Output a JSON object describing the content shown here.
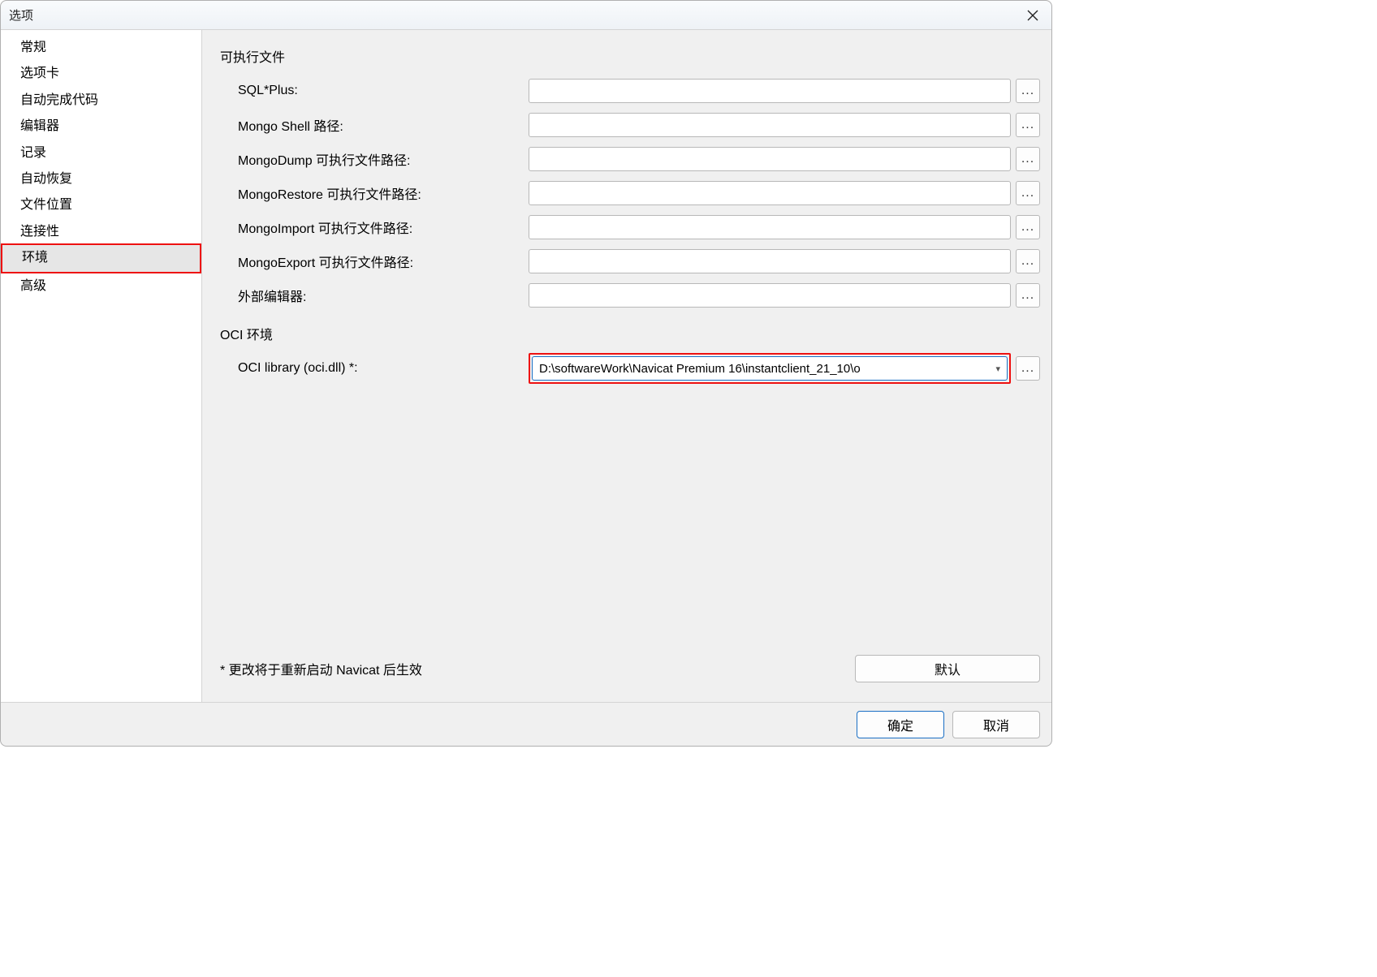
{
  "window": {
    "title": "选项"
  },
  "sidebar": {
    "items": [
      {
        "label": "常规"
      },
      {
        "label": "选项卡"
      },
      {
        "label": "自动完成代码"
      },
      {
        "label": "编辑器"
      },
      {
        "label": "记录"
      },
      {
        "label": "自动恢复"
      },
      {
        "label": "文件位置"
      },
      {
        "label": "连接性"
      },
      {
        "label": "环境",
        "selected": true,
        "highlighted": true
      },
      {
        "label": "高级"
      }
    ]
  },
  "main": {
    "executables_section": "可执行文件",
    "fields": [
      {
        "label": "SQL*Plus:",
        "value": ""
      },
      {
        "label": "Mongo Shell 路径:",
        "value": ""
      },
      {
        "label": "MongoDump 可执行文件路径:",
        "value": ""
      },
      {
        "label": "MongoRestore 可执行文件路径:",
        "value": ""
      },
      {
        "label": "MongoImport 可执行文件路径:",
        "value": ""
      },
      {
        "label": "MongoExport 可执行文件路径:",
        "value": ""
      },
      {
        "label": "外部编辑器:",
        "value": ""
      }
    ],
    "oci_section": "OCI 环境",
    "oci_label": "OCI library (oci.dll) *:",
    "oci_value": "D:\\softwareWork\\Navicat Premium 16\\instantclient_21_10\\o",
    "note": "* 更改将于重新启动 Navicat 后生效",
    "default_btn": "默认"
  },
  "footer": {
    "ok": "确定",
    "cancel": "取消"
  },
  "browse_label": "..."
}
